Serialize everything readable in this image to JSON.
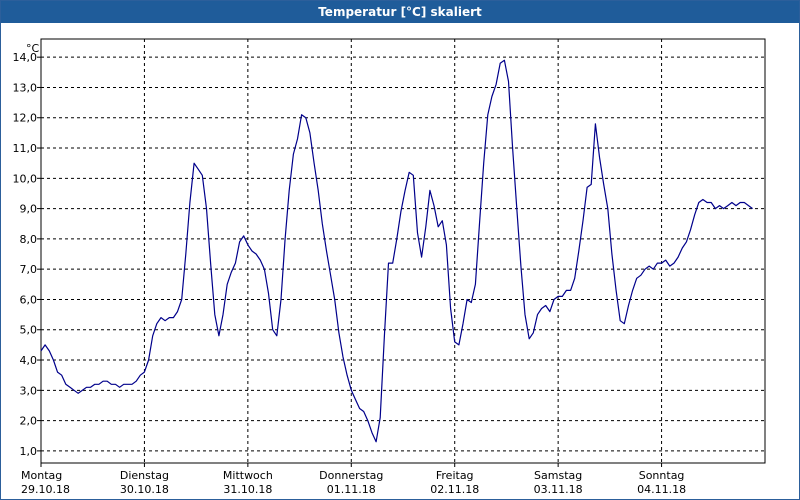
{
  "window": {
    "title": "Temperatur [°C] skaliert"
  },
  "colors": {
    "titlebar": "#1f5c9a",
    "line": "#00008b",
    "grid": "#000000"
  },
  "chart_data": {
    "type": "line",
    "title": "Temperatur [°C] skaliert",
    "ylabel": "°C",
    "xlabel": "",
    "ylim": [
      0.6,
      14.6
    ],
    "y_ticks": [
      "1,0",
      "2,0",
      "3,0",
      "4,0",
      "5,0",
      "6,0",
      "7,0",
      "8,0",
      "9,0",
      "10,0",
      "11,0",
      "12,0",
      "13,0",
      "14,0"
    ],
    "x_ticks": [
      {
        "day": "Montag",
        "date": "29.10.18"
      },
      {
        "day": "Dienstag",
        "date": "30.10.18"
      },
      {
        "day": "Mittwoch",
        "date": "31.10.18"
      },
      {
        "day": "Donnerstag",
        "date": "01.11.18"
      },
      {
        "day": "Freitag",
        "date": "02.11.18"
      },
      {
        "day": "Samstag",
        "date": "03.11.18"
      },
      {
        "day": "Sonntag",
        "date": "04.11.18"
      }
    ],
    "grid": true,
    "series": [
      {
        "values": [
          [
            0.0,
            4.3
          ],
          [
            0.04,
            4.5
          ],
          [
            0.08,
            4.3
          ],
          [
            0.12,
            4.0
          ],
          [
            0.16,
            3.6
          ],
          [
            0.2,
            3.5
          ],
          [
            0.24,
            3.2
          ],
          [
            0.28,
            3.1
          ],
          [
            0.32,
            3.0
          ],
          [
            0.36,
            2.9
          ],
          [
            0.4,
            3.0
          ],
          [
            0.44,
            3.1
          ],
          [
            0.48,
            3.1
          ],
          [
            0.52,
            3.2
          ],
          [
            0.56,
            3.2
          ],
          [
            0.6,
            3.3
          ],
          [
            0.64,
            3.3
          ],
          [
            0.68,
            3.2
          ],
          [
            0.72,
            3.2
          ],
          [
            0.76,
            3.1
          ],
          [
            0.8,
            3.2
          ],
          [
            0.84,
            3.2
          ],
          [
            0.88,
            3.2
          ],
          [
            0.92,
            3.3
          ],
          [
            0.96,
            3.5
          ],
          [
            1.0,
            3.6
          ],
          [
            1.04,
            4.0
          ],
          [
            1.08,
            4.8
          ],
          [
            1.12,
            5.2
          ],
          [
            1.16,
            5.4
          ],
          [
            1.2,
            5.3
          ],
          [
            1.24,
            5.4
          ],
          [
            1.28,
            5.4
          ],
          [
            1.32,
            5.6
          ],
          [
            1.36,
            6.0
          ],
          [
            1.4,
            7.5
          ],
          [
            1.44,
            9.2
          ],
          [
            1.48,
            10.5
          ],
          [
            1.52,
            10.3
          ],
          [
            1.56,
            10.1
          ],
          [
            1.6,
            9.0
          ],
          [
            1.64,
            7.2
          ],
          [
            1.68,
            5.5
          ],
          [
            1.72,
            4.8
          ],
          [
            1.76,
            5.5
          ],
          [
            1.8,
            6.5
          ],
          [
            1.84,
            6.9
          ],
          [
            1.88,
            7.2
          ],
          [
            1.92,
            7.9
          ],
          [
            1.96,
            8.1
          ],
          [
            2.0,
            7.8
          ],
          [
            2.04,
            7.6
          ],
          [
            2.08,
            7.5
          ],
          [
            2.12,
            7.3
          ],
          [
            2.16,
            7.0
          ],
          [
            2.2,
            6.2
          ],
          [
            2.24,
            5.0
          ],
          [
            2.28,
            4.8
          ],
          [
            2.32,
            6.0
          ],
          [
            2.36,
            8.0
          ],
          [
            2.4,
            9.6
          ],
          [
            2.44,
            10.8
          ],
          [
            2.48,
            11.3
          ],
          [
            2.52,
            12.1
          ],
          [
            2.56,
            12.0
          ],
          [
            2.6,
            11.5
          ],
          [
            2.64,
            10.5
          ],
          [
            2.68,
            9.6
          ],
          [
            2.72,
            8.5
          ],
          [
            2.76,
            7.6
          ],
          [
            2.8,
            6.8
          ],
          [
            2.84,
            6.0
          ],
          [
            2.88,
            4.9
          ],
          [
            2.92,
            4.1
          ],
          [
            2.96,
            3.5
          ],
          [
            3.0,
            3.0
          ],
          [
            3.04,
            2.7
          ],
          [
            3.08,
            2.4
          ],
          [
            3.12,
            2.3
          ],
          [
            3.16,
            2.0
          ],
          [
            3.2,
            1.6
          ],
          [
            3.24,
            1.3
          ],
          [
            3.28,
            2.1
          ],
          [
            3.32,
            4.8
          ],
          [
            3.36,
            7.2
          ],
          [
            3.4,
            7.2
          ],
          [
            3.44,
            8.0
          ],
          [
            3.48,
            8.9
          ],
          [
            3.52,
            9.6
          ],
          [
            3.56,
            10.2
          ],
          [
            3.6,
            10.1
          ],
          [
            3.64,
            8.2
          ],
          [
            3.68,
            7.4
          ],
          [
            3.72,
            8.4
          ],
          [
            3.76,
            9.6
          ],
          [
            3.8,
            9.1
          ],
          [
            3.84,
            8.4
          ],
          [
            3.88,
            8.6
          ],
          [
            3.92,
            7.8
          ],
          [
            3.96,
            5.7
          ],
          [
            4.0,
            4.6
          ],
          [
            4.04,
            4.5
          ],
          [
            4.08,
            5.2
          ],
          [
            4.12,
            6.0
          ],
          [
            4.16,
            5.9
          ],
          [
            4.2,
            6.5
          ],
          [
            4.24,
            8.5
          ],
          [
            4.28,
            10.5
          ],
          [
            4.32,
            12.1
          ],
          [
            4.36,
            12.7
          ],
          [
            4.4,
            13.1
          ],
          [
            4.44,
            13.8
          ],
          [
            4.48,
            13.9
          ],
          [
            4.52,
            13.2
          ],
          [
            4.56,
            11.0
          ],
          [
            4.6,
            9.0
          ],
          [
            4.64,
            7.1
          ],
          [
            4.68,
            5.5
          ],
          [
            4.72,
            4.7
          ],
          [
            4.76,
            4.9
          ],
          [
            4.8,
            5.5
          ],
          [
            4.84,
            5.7
          ],
          [
            4.88,
            5.8
          ],
          [
            4.92,
            5.6
          ],
          [
            4.96,
            6.0
          ],
          [
            5.0,
            6.1
          ],
          [
            5.04,
            6.1
          ],
          [
            5.08,
            6.3
          ],
          [
            5.12,
            6.3
          ],
          [
            5.16,
            6.7
          ],
          [
            5.2,
            7.6
          ],
          [
            5.24,
            8.6
          ],
          [
            5.28,
            9.7
          ],
          [
            5.32,
            9.8
          ],
          [
            5.36,
            11.8
          ],
          [
            5.4,
            10.7
          ],
          [
            5.44,
            9.8
          ],
          [
            5.48,
            9.0
          ],
          [
            5.52,
            7.5
          ],
          [
            5.56,
            6.3
          ],
          [
            5.6,
            5.3
          ],
          [
            5.64,
            5.2
          ],
          [
            5.68,
            5.8
          ],
          [
            5.72,
            6.3
          ],
          [
            5.76,
            6.7
          ],
          [
            5.8,
            6.8
          ],
          [
            5.84,
            7.0
          ],
          [
            5.88,
            7.1
          ],
          [
            5.92,
            7.0
          ],
          [
            5.96,
            7.2
          ],
          [
            6.0,
            7.2
          ],
          [
            6.04,
            7.3
          ],
          [
            6.08,
            7.1
          ],
          [
            6.12,
            7.2
          ],
          [
            6.16,
            7.4
          ],
          [
            6.2,
            7.7
          ],
          [
            6.24,
            7.9
          ],
          [
            6.28,
            8.3
          ],
          [
            6.32,
            8.8
          ],
          [
            6.36,
            9.2
          ],
          [
            6.4,
            9.3
          ],
          [
            6.44,
            9.2
          ],
          [
            6.48,
            9.2
          ],
          [
            6.52,
            9.0
          ],
          [
            6.56,
            9.1
          ],
          [
            6.6,
            9.0
          ],
          [
            6.64,
            9.1
          ],
          [
            6.68,
            9.2
          ],
          [
            6.72,
            9.1
          ],
          [
            6.76,
            9.2
          ],
          [
            6.8,
            9.2
          ],
          [
            6.84,
            9.1
          ],
          [
            6.88,
            9.0
          ]
        ]
      }
    ]
  }
}
